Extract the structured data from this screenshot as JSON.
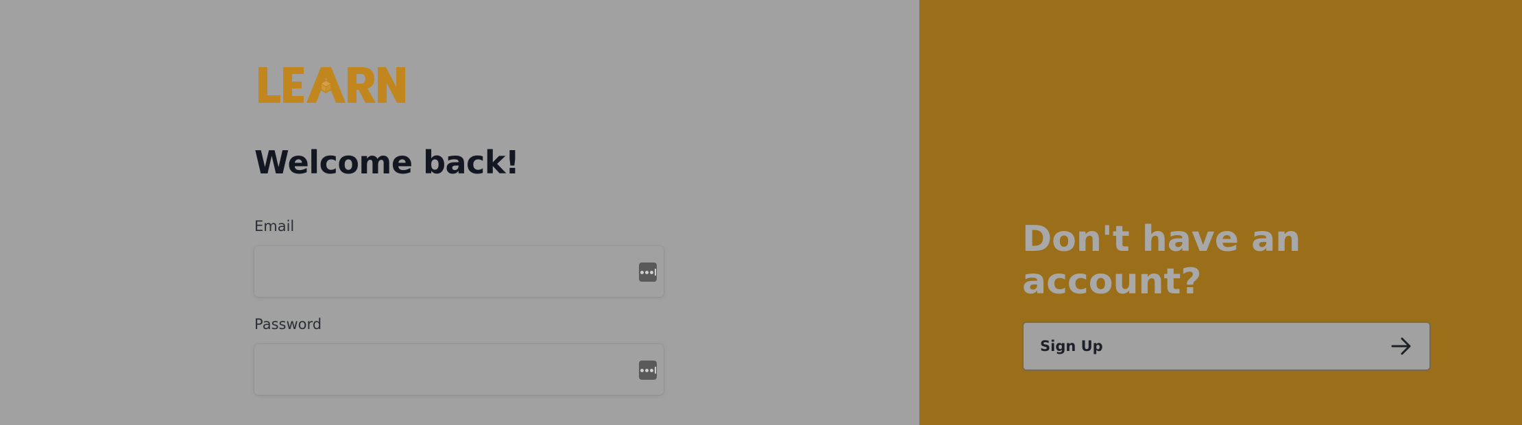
{
  "brand": {
    "logo_text": "LEARN",
    "logo_color": "#c1861d"
  },
  "login": {
    "heading": "Welcome back!",
    "email_label": "Email",
    "email_value": "",
    "password_label": "Password",
    "password_value": ""
  },
  "signup": {
    "heading": "Don't have an account?",
    "button_label": "Sign Up"
  },
  "colors": {
    "left_background": "#a1a1a1",
    "right_background": "#9b6f1a",
    "heading_text": "#131722",
    "signup_heading_text": "#a8a8a8"
  },
  "icons": {
    "field_icon": "password-manager-icon",
    "signup_icon": "arrow-right-icon"
  }
}
